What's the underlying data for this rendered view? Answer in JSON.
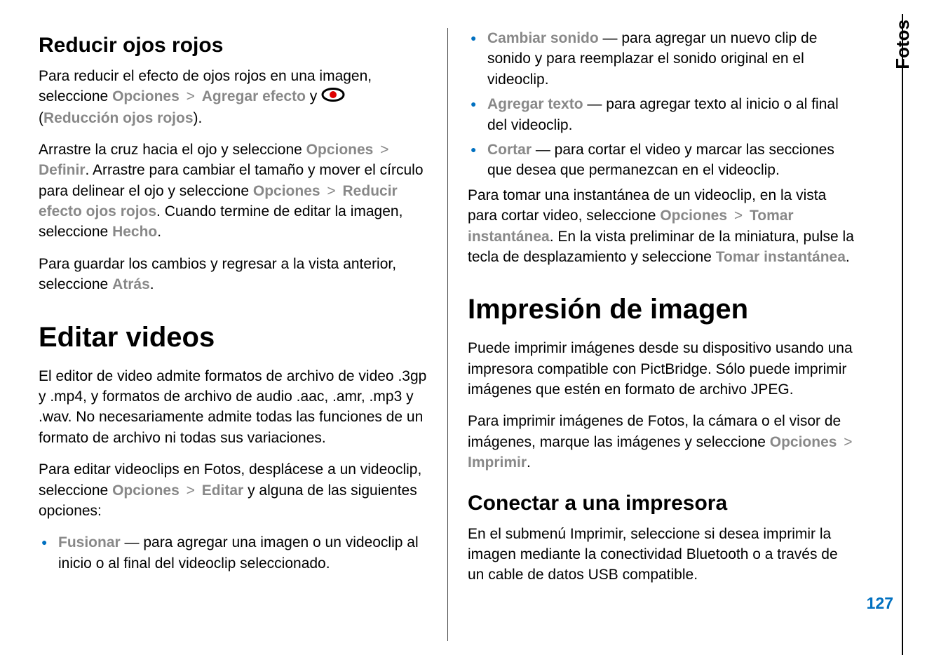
{
  "side": {
    "tab": "Fotos",
    "page": "127"
  },
  "left": {
    "h2_1": "Reducir ojos rojos",
    "p1_a": "Para reducir el efecto de ojos rojos en una imagen, seleccione ",
    "p1_opciones": "Opciones",
    "p1_agregar": "Agregar efecto",
    "p1_y": " y ",
    "p1_open": "(",
    "p1_red": "Reducción ojos rojos",
    "p1_close": ").",
    "p2_a": "Arrastre la cruz hacia el ojo y seleccione ",
    "p2_opciones": "Opciones",
    "p2_definir": "Definir",
    "p2_b": ". Arrastre para cambiar el tamaño y mover el círculo para delinear el ojo y seleccione ",
    "p2_opciones2": "Opciones",
    "p2_reducir": "Reducir efecto ojos rojos",
    "p2_c": ". Cuando termine de editar la imagen, seleccione ",
    "p2_hecho": "Hecho",
    "p2_d": ".",
    "p3_a": "Para guardar los cambios y regresar a la vista anterior, seleccione ",
    "p3_atras": "Atrás",
    "p3_b": ".",
    "h1_1": "Editar videos",
    "p4": "El editor de video admite formatos de archivo de video .3gp y .mp4, y formatos de archivo de audio .aac, .amr, .mp3 y .wav. No necesariamente admite todas las funciones de un formato de archivo ni todas sus variaciones.",
    "p5_a": "Para editar videoclips en Fotos, desplácese a un videoclip, seleccione ",
    "p5_opciones": "Opciones",
    "p5_editar": "Editar",
    "p5_b": " y alguna de las siguientes opciones:",
    "li1_hl": "Fusionar",
    "li1_txt": " — para agregar una imagen o un videoclip al inicio o al final del videoclip seleccionado."
  },
  "right": {
    "li2_hl": "Cambiar sonido",
    "li2_txt": " — para agregar un nuevo clip de sonido y para reemplazar el sonido original en el videoclip.",
    "li3_hl": "Agregar texto",
    "li3_txt": " — para agregar texto al inicio o al final del videoclip.",
    "li4_hl": "Cortar",
    "li4_txt": " — para cortar el video y marcar las secciones que desea que permanezcan en el videoclip.",
    "p6_a": "Para tomar una instantánea de un videoclip, en la vista para cortar video, seleccione ",
    "p6_opciones": "Opciones",
    "p6_tomar": "Tomar instantánea",
    "p6_b": ". En la vista preliminar de la miniatura, pulse la tecla de desplazamiento y seleccione ",
    "p6_tomar2": "Tomar instantánea",
    "p6_c": ".",
    "h1_2": "Impresión de imagen",
    "p7": "Puede imprimir imágenes desde su dispositivo usando una impresora compatible con PictBridge. Sólo puede imprimir imágenes que estén en formato de archivo JPEG.",
    "p8_a": "Para imprimir imágenes de Fotos, la cámara o el visor de imágenes, marque las imágenes y seleccione ",
    "p8_opciones": "Opciones",
    "p8_imprimir": "Imprimir",
    "p8_b": ".",
    "h3_1": "Conectar a una impresora",
    "p9": "En el submenú Imprimir, seleccione si desea imprimir la imagen mediante la conectividad Bluetooth o a través de un cable de datos USB compatible."
  }
}
